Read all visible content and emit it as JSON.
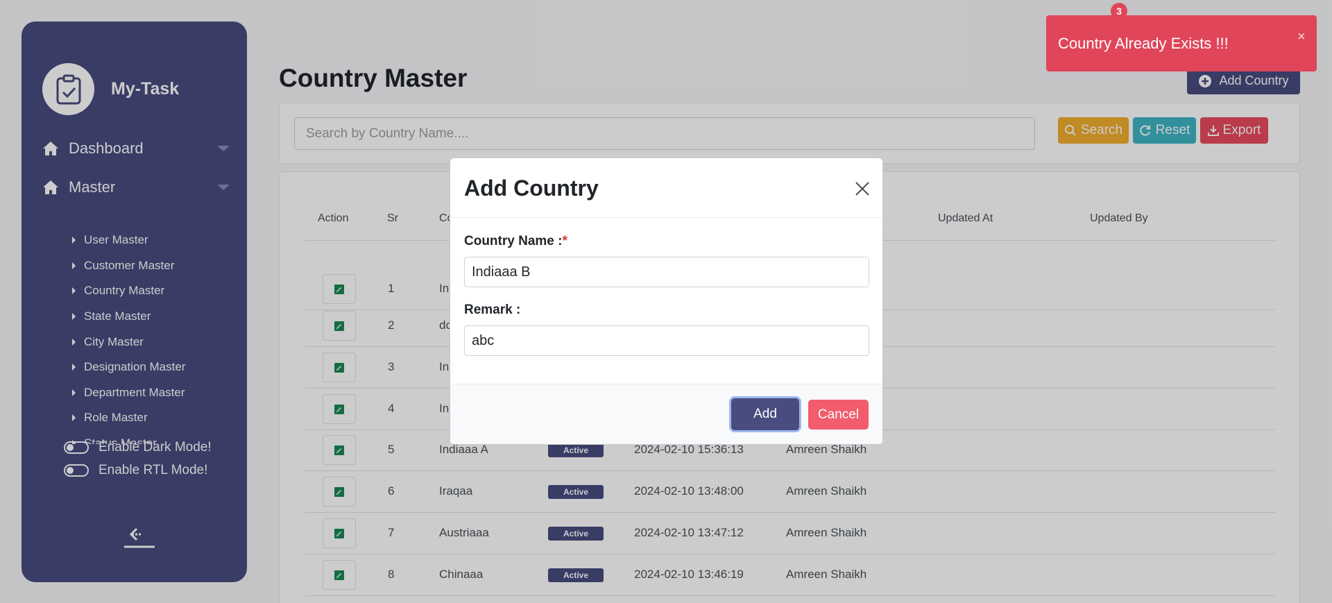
{
  "app": {
    "brand_name": "My-Task"
  },
  "sidebar": {
    "menu": [
      {
        "label": "Dashboard",
        "icon": "home-icon"
      },
      {
        "label": "Master",
        "icon": "home-icon"
      }
    ],
    "submenu": [
      "User Master",
      "Customer Master",
      "Country Master",
      "State Master",
      "City Master",
      "Designation Master",
      "Department Master",
      "Role Master",
      "Status Master"
    ],
    "toggles": {
      "dark_mode": "Enable Dark Mode!",
      "rtl_mode": "Enable RTL Mode!"
    }
  },
  "page": {
    "title": "Country Master",
    "add_button": "Add Country"
  },
  "search": {
    "placeholder": "Search by Country Name....",
    "search_label": "Search",
    "reset_label": "Reset",
    "export_label": "Export"
  },
  "table": {
    "headers": [
      "Action",
      "Sr",
      "Co",
      "Updated At",
      "Updated By"
    ],
    "rows": [
      {
        "sr": "1",
        "name": "In",
        "status": "",
        "created_at": "",
        "created_by": ""
      },
      {
        "sr": "2",
        "name": "dc",
        "status": "",
        "created_at": "",
        "created_by": ""
      },
      {
        "sr": "3",
        "name": "In",
        "status": "",
        "created_at": "",
        "created_by": ""
      },
      {
        "sr": "4",
        "name": "In",
        "status": "",
        "created_at": "",
        "created_by": ""
      },
      {
        "sr": "5",
        "name": "Indiaaa A",
        "status": "Active",
        "created_at": "2024-02-10 15:36:13",
        "created_by": "Amreen Shaikh"
      },
      {
        "sr": "6",
        "name": "Iraqaa",
        "status": "Active",
        "created_at": "2024-02-10 13:48:00",
        "created_by": "Amreen Shaikh"
      },
      {
        "sr": "7",
        "name": "Austriaaa",
        "status": "Active",
        "created_at": "2024-02-10 13:47:12",
        "created_by": "Amreen Shaikh"
      },
      {
        "sr": "8",
        "name": "Chinaaa",
        "status": "Active",
        "created_at": "2024-02-10 13:46:19",
        "created_by": "Amreen Shaikh"
      }
    ]
  },
  "modal": {
    "title": "Add Country",
    "country_label": "Country Name :",
    "required_mark": "*",
    "country_value": "Indiaaa B",
    "remark_label": "Remark :",
    "remark_value": "abc",
    "add_label": "Add",
    "cancel_label": "Cancel"
  },
  "toast": {
    "message": "Country Already Exists !!!",
    "close": "×",
    "badge_count": "3"
  },
  "colors": {
    "primary": "#484c7f",
    "danger": "#e0455a",
    "warning": "#f0ad2e",
    "info": "#3fb5c5",
    "success_icon": "#198754"
  }
}
